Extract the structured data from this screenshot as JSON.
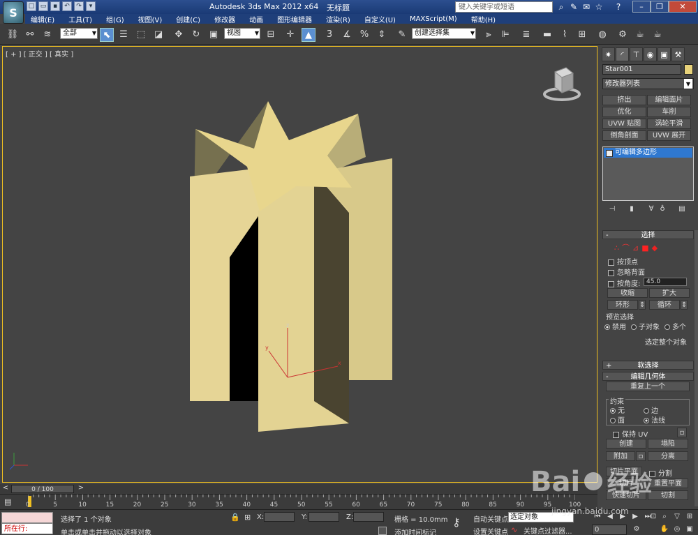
{
  "titlebar": {
    "app_title": "Autodesk 3ds Max  2012 x64",
    "doc_title": "无标题",
    "search_placeholder": "键入关键字或短语",
    "logo_glyph": "S"
  },
  "menu": [
    "编辑(E)",
    "工具(T)",
    "组(G)",
    "视图(V)",
    "创建(C)",
    "修改器",
    "动画",
    "图形编辑器",
    "渲染(R)",
    "自定义(U)",
    "MAXScript(M)",
    "帮助(H)"
  ],
  "toolbar": {
    "selection_filter": "全部",
    "reference_coord": "视图",
    "named_selection": "创建选择集"
  },
  "viewport": {
    "label": "[ + ] [ 正交 ] [ 真实 ]",
    "axis_x": "x",
    "axis_y": "y",
    "axis_z": "z"
  },
  "command_panel": {
    "object_name": "Star001",
    "modifier_list": "修改器列表",
    "modifier_buttons": [
      "挤出",
      "编辑面片",
      "优化",
      "车削",
      "UVW 贴图",
      "涡轮平滑",
      "倒角剖面",
      "UVW 展开"
    ],
    "stack_item": "可编辑多边形",
    "selection": {
      "title": "选择",
      "by_vertex": "按顶点",
      "ignore_backfacing": "忽略背面",
      "by_angle": "按角度:",
      "angle_value": "45.0",
      "shrink": "收缩",
      "grow": "扩大",
      "ring": "环形",
      "loop": "循环",
      "preview_group": "预览选择",
      "preview_disabled": "禁用",
      "preview_subobject": "子对象",
      "preview_multi": "多个",
      "status": "选定整个对象"
    },
    "soft_selection": "软选择",
    "edit_geometry": {
      "title": "编辑几何体",
      "repeat_last": "重复上一个",
      "constraints": "约束",
      "none": "无",
      "edge": "边",
      "face": "面",
      "normal": "法线",
      "preserve_uv": "保持 UV",
      "create": "创建",
      "collapse": "塌陷",
      "attach": "附加",
      "detach": "分离",
      "slice_plane": "切片平面",
      "split": "分割",
      "slice": "切片",
      "reset_plane": "重置平面",
      "quickslice": "快速切片",
      "cut": "切割"
    }
  },
  "timeline": {
    "frame_display": "0 / 100",
    "ticks": [
      "0",
      "5",
      "10",
      "15",
      "20",
      "25",
      "30",
      "35",
      "40",
      "45",
      "50",
      "55",
      "60",
      "65",
      "70",
      "75",
      "80",
      "85",
      "90",
      "95",
      "100"
    ]
  },
  "status": {
    "listener": "所在行:",
    "selection": "选择了 1 个对象",
    "prompt": "单击或单击并拖动以选择对象",
    "x_label": "X:",
    "y_label": "Y:",
    "z_label": "Z:",
    "grid": "栅格 = 10.0mm",
    "add_time_tag": "添加时间标记",
    "auto_key": "自动关键点",
    "set_key": "设置关键点",
    "selected": "选定对象",
    "key_filters": "关键点过滤器...",
    "frame": "0"
  },
  "watermark": {
    "brand": "Bai",
    "brand2": "经验",
    "url": "jingyan.baidu.com"
  },
  "colors": {
    "object": "#e7d27a",
    "viewport_border": "#f0c020",
    "selection_highlight": "#2f78d0"
  }
}
